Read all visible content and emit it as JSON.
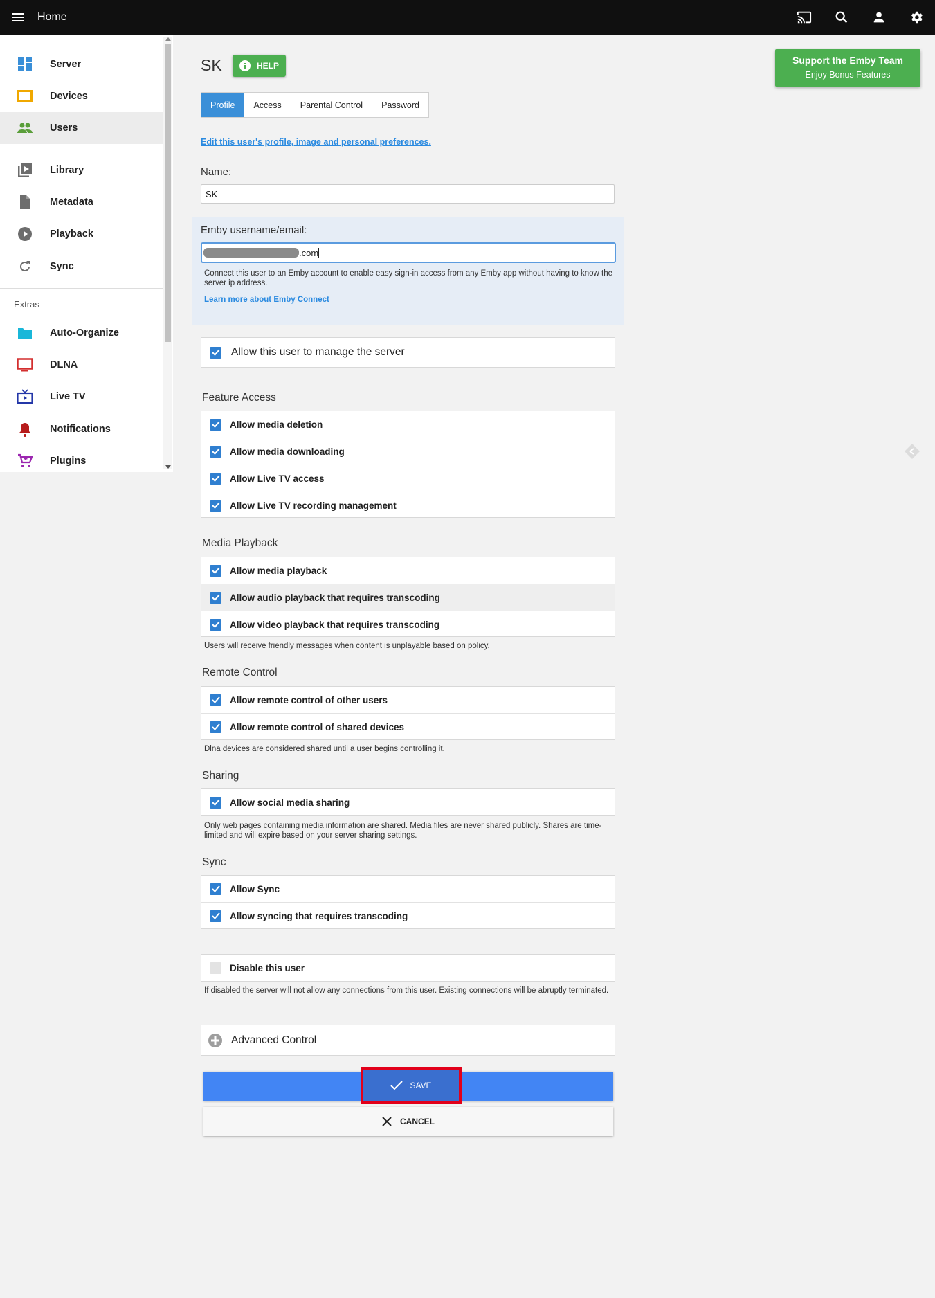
{
  "topbar": {
    "home_label": "Home"
  },
  "sidebar": {
    "items": [
      {
        "label": "Server",
        "icon": "dashboard-icon"
      },
      {
        "label": "Devices",
        "icon": "devices-icon"
      },
      {
        "label": "Users",
        "icon": "people-icon"
      },
      {
        "label": "Library",
        "icon": "library-icon"
      },
      {
        "label": "Metadata",
        "icon": "document-icon"
      },
      {
        "label": "Playback",
        "icon": "play-circle-icon"
      },
      {
        "label": "Sync",
        "icon": "sync-icon"
      }
    ],
    "extras_header": "Extras",
    "extras": [
      {
        "label": "Auto-Organize",
        "icon": "folder-icon"
      },
      {
        "label": "DLNA",
        "icon": "tv-icon"
      },
      {
        "label": "Live TV",
        "icon": "live-tv-icon"
      },
      {
        "label": "Notifications",
        "icon": "bell-icon"
      },
      {
        "label": "Plugins",
        "icon": "cart-icon"
      }
    ]
  },
  "colors": {
    "accent_blue": "#3a8fd8",
    "save_blue": "#4285f4",
    "green": "#4caf50",
    "highlight_red": "#e2001a"
  },
  "page": {
    "title": "SK",
    "help_label": "HELP",
    "support": {
      "line1": "Support the Emby Team",
      "line2": "Enjoy Bonus Features"
    },
    "tabs": [
      "Profile",
      "Access",
      "Parental Control",
      "Password"
    ],
    "edit_link": "Edit this user's profile, image and personal preferences.",
    "name_label": "Name:",
    "name_value": "SK",
    "email_label": "Emby username/email:",
    "email_suffix": ".com",
    "connect_help": "Connect this user to an Emby account to enable easy sign-in access from any Emby app without having to know the server ip address.",
    "connect_link": "Learn more about Emby Connect",
    "manage_server": "Allow this user to manage the server",
    "feature_title": "Feature Access",
    "feature_items": [
      "Allow media deletion",
      "Allow media downloading",
      "Allow Live TV access",
      "Allow Live TV recording management"
    ],
    "playback_title": "Media Playback",
    "playback_items": [
      "Allow media playback",
      "Allow audio playback that requires transcoding",
      "Allow video playback that requires transcoding"
    ],
    "playback_note": "Users will receive friendly messages when content is unplayable based on policy.",
    "remote_title": "Remote Control",
    "remote_items": [
      "Allow remote control of other users",
      "Allow remote control of shared devices"
    ],
    "remote_note": "Dlna devices are considered shared until a user begins controlling it.",
    "sharing_title": "Sharing",
    "sharing_items": [
      "Allow social media sharing"
    ],
    "sharing_note": "Only web pages containing media information are shared. Media files are never shared publicly. Shares are time-limited and will expire based on your server sharing settings.",
    "sync_title": "Sync",
    "sync_items": [
      "Allow Sync",
      "Allow syncing that requires transcoding"
    ],
    "disable_label": "Disable this user",
    "disable_note": "If disabled the server will not allow any connections from this user. Existing connections will be abruptly terminated.",
    "advanced_label": "Advanced Control",
    "save_label": "SAVE",
    "cancel_label": "CANCEL"
  }
}
